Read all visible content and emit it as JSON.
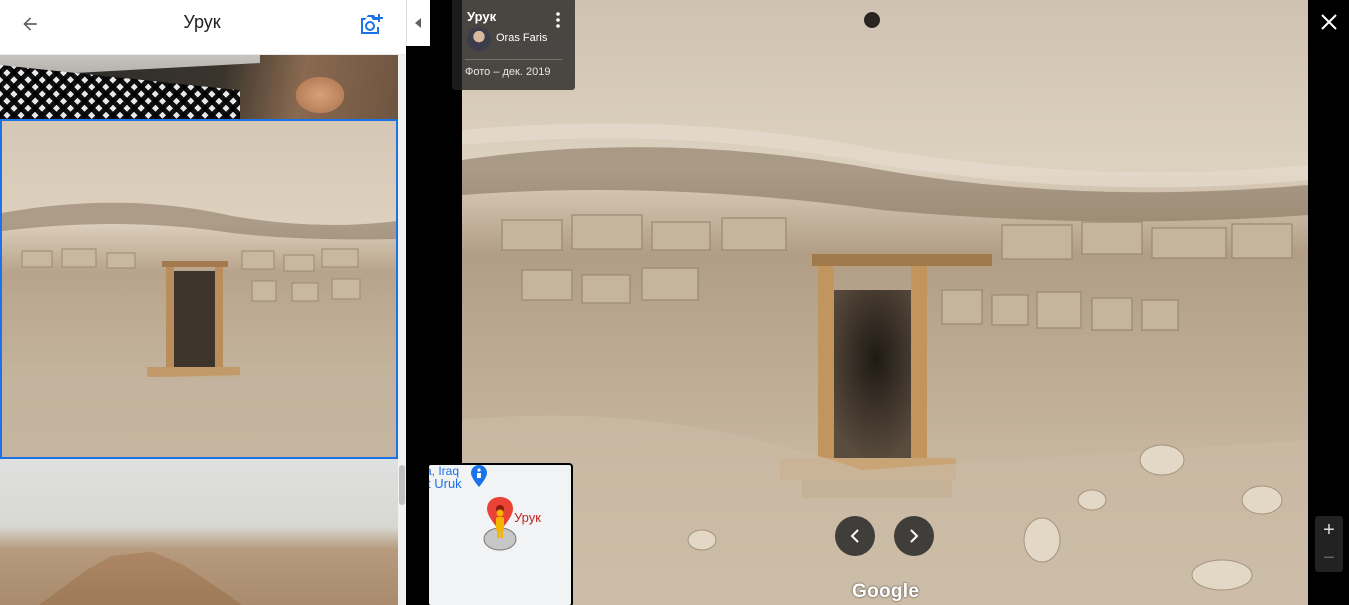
{
  "panel": {
    "title": "Урук",
    "back_icon": "arrow-back-icon",
    "add_photo_icon": "add-photo-camera-icon"
  },
  "photo_info": {
    "place": "Урук",
    "author": "Oras Faris",
    "date": "Фото – дек. 2019"
  },
  "minimap": {
    "region_label": "a, Iraq",
    "place_label": "t Uruk",
    "current_label": "Урук"
  },
  "viewer": {
    "logo": "Google",
    "zoom_in": "+",
    "zoom_out": "−"
  },
  "colors": {
    "accent": "#1a73e8",
    "map_pin": "#ea4335",
    "poi": "#1a73e8"
  }
}
